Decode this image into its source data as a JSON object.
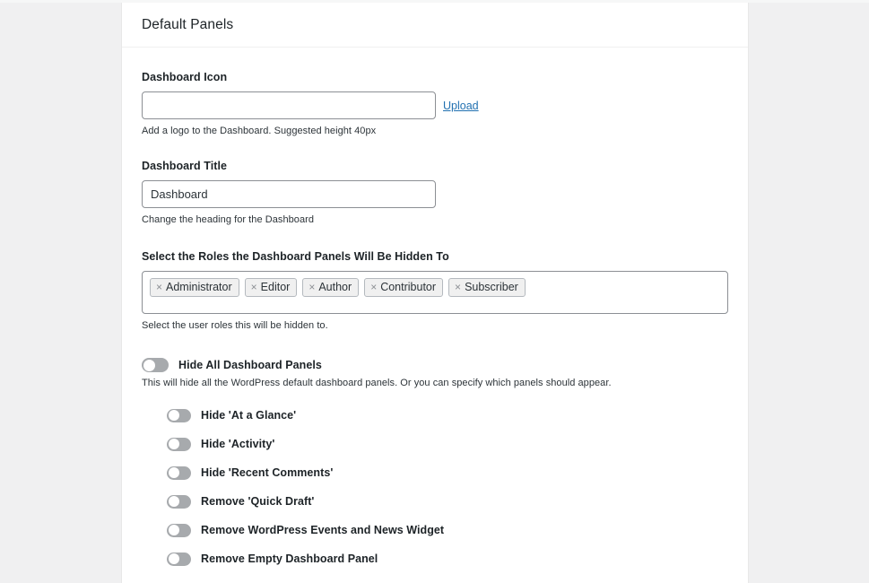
{
  "card": {
    "title": "Default Panels"
  },
  "dashboard_icon": {
    "label": "Dashboard Icon",
    "value": "",
    "placeholder": "",
    "upload_label": "Upload",
    "description": "Add a logo to the Dashboard. Suggested height 40px"
  },
  "dashboard_title": {
    "label": "Dashboard Title",
    "value": "Dashboard",
    "placeholder": "",
    "description": "Change the heading for the Dashboard"
  },
  "roles": {
    "label": "Select the Roles the Dashboard Panels Will Be Hidden To",
    "description": "Select the user roles this will be hidden to.",
    "remove_icon": "×",
    "tags": [
      {
        "label": "Administrator"
      },
      {
        "label": "Editor"
      },
      {
        "label": "Author"
      },
      {
        "label": "Contributor"
      },
      {
        "label": "Subscriber"
      }
    ]
  },
  "hide_all": {
    "label": "Hide All Dashboard Panels",
    "description": "This will hide all the WordPress default dashboard panels. Or you can specify which panels should appear.",
    "state": "off"
  },
  "panel_toggles": [
    {
      "label": "Hide 'At a Glance'",
      "state": "off"
    },
    {
      "label": "Hide 'Activity'",
      "state": "off"
    },
    {
      "label": "Hide 'Recent Comments'",
      "state": "off"
    },
    {
      "label": "Remove 'Quick Draft'",
      "state": "off"
    },
    {
      "label": "Remove WordPress Events and News Widget",
      "state": "off"
    },
    {
      "label": "Remove Empty Dashboard Panel",
      "state": "off"
    }
  ],
  "colors": {
    "page_background": "#f0f0f1",
    "card_background": "#ffffff",
    "link": "#2271b1",
    "text": "#1d2327",
    "border": "#8c8f94",
    "switch_track": "#a7aaad"
  }
}
